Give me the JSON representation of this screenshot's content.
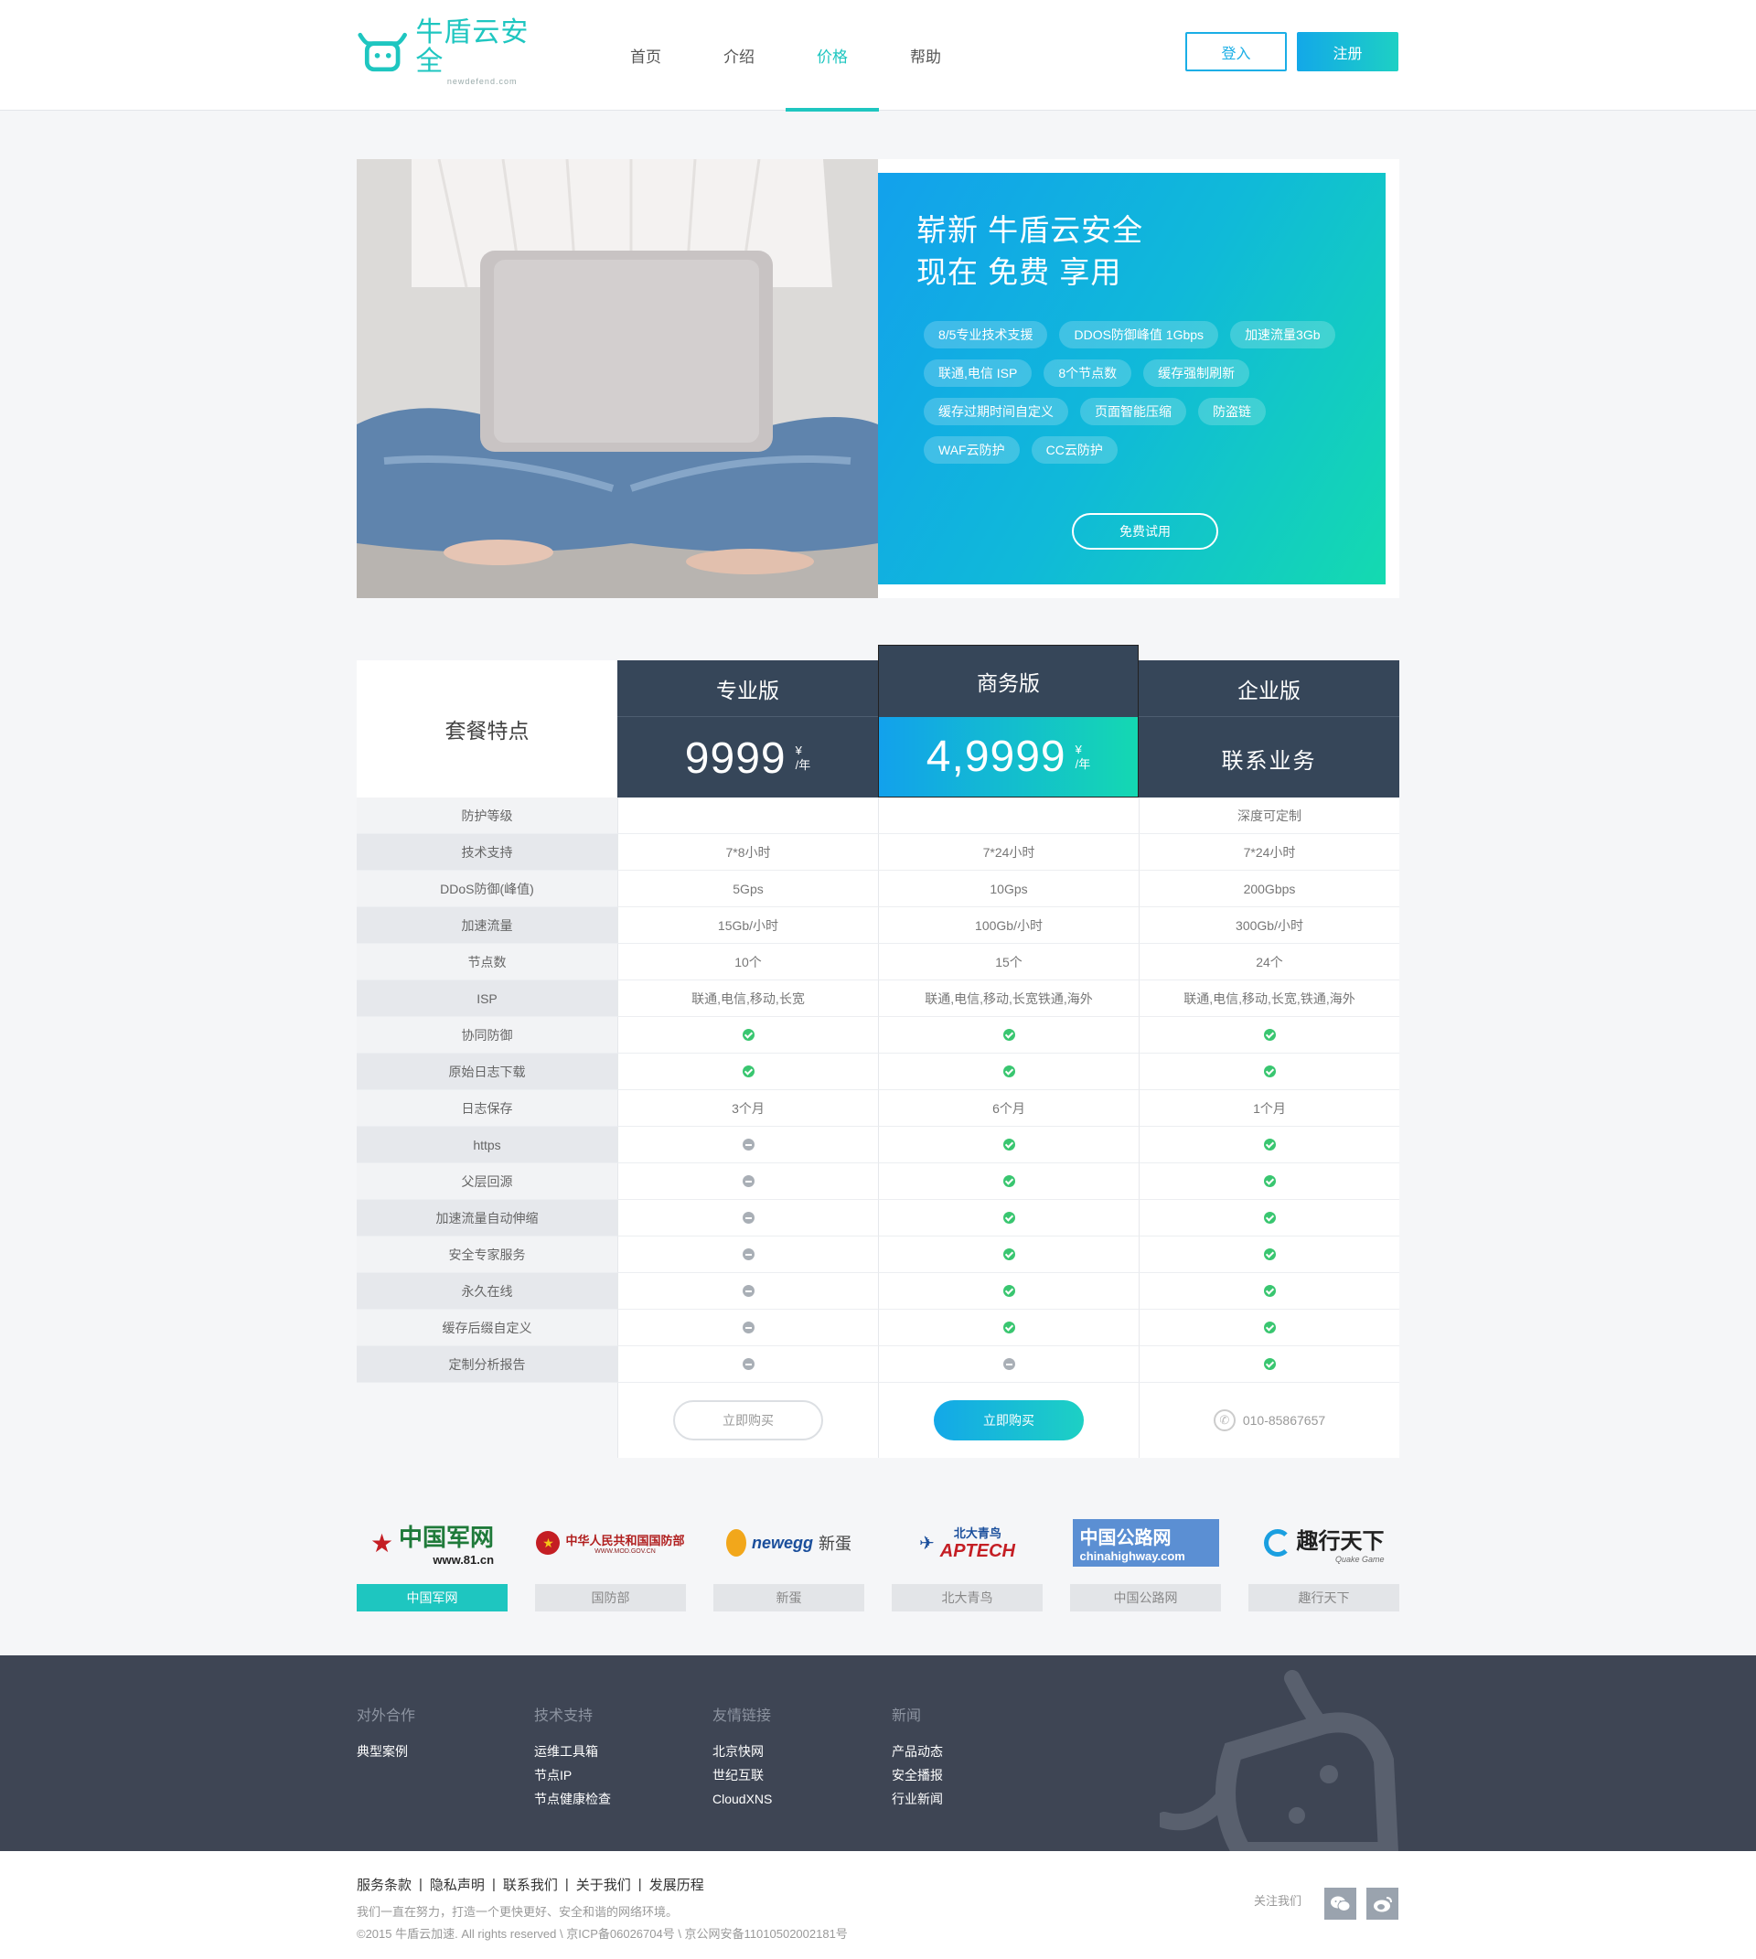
{
  "brand": {
    "name": "牛盾云安全",
    "domain": "newdefend.com",
    "accent": "#1ec6c0",
    "blue": "#13a8e8"
  },
  "nav": {
    "items": [
      "首页",
      "介绍",
      "价格",
      "帮助"
    ],
    "active": "价格",
    "login": "登入",
    "register": "注册"
  },
  "hero": {
    "title_line1": "崭新 牛盾云安全",
    "title_line2": "现在 免费 享用",
    "tags": [
      "8/5专业技术支援",
      "DDOS防御峰值 1Gbps",
      "加速流量3Gb",
      "联通,电信 ISP",
      "8个节点数",
      "缓存强制刷新",
      "缓存过期时间自定义",
      "页面智能压缩",
      "防盗链",
      "WAF云防护",
      "CC云防护"
    ],
    "cta": "免费试用"
  },
  "pricing": {
    "feature_header": "套餐特点",
    "plans": [
      {
        "name": "专业版",
        "price": "9999",
        "currency": "¥",
        "per": "/年"
      },
      {
        "name": "商务版",
        "price": "4,9999",
        "currency": "¥",
        "per": "/年"
      },
      {
        "name": "企业版",
        "contact": "联系业务"
      }
    ],
    "rows": [
      {
        "feature": "防护等级",
        "values": [
          "",
          "",
          "深度可定制"
        ]
      },
      {
        "feature": "技术支持",
        "values": [
          "7*8小时",
          "7*24小时",
          "7*24小时"
        ]
      },
      {
        "feature": "DDoS防御(峰值)",
        "values": [
          "5Gps",
          "10Gps",
          "200Gbps"
        ]
      },
      {
        "feature": "加速流量",
        "values": [
          "15Gb/小时",
          "100Gb/小时",
          "300Gb/小时"
        ]
      },
      {
        "feature": "节点数",
        "values": [
          "10个",
          "15个",
          "24个"
        ]
      },
      {
        "feature": "ISP",
        "values": [
          "联通,电信,移动,长宽",
          "联通,电信,移动,长宽铁通,海外",
          "联通,电信,移动,长宽,铁通,海外"
        ]
      },
      {
        "feature": "协同防御",
        "values": [
          "yes",
          "yes",
          "yes"
        ]
      },
      {
        "feature": "原始日志下载",
        "values": [
          "yes",
          "yes",
          "yes"
        ]
      },
      {
        "feature": "日志保存",
        "values": [
          "3个月",
          "6个月",
          "1个月"
        ]
      },
      {
        "feature": "https",
        "values": [
          "no",
          "yes",
          "yes"
        ]
      },
      {
        "feature": "父层回源",
        "values": [
          "no",
          "yes",
          "yes"
        ]
      },
      {
        "feature": "加速流量自动伸缩",
        "values": [
          "no",
          "yes",
          "yes"
        ]
      },
      {
        "feature": "安全专家服务",
        "values": [
          "no",
          "yes",
          "yes"
        ]
      },
      {
        "feature": "永久在线",
        "values": [
          "no",
          "yes",
          "yes"
        ]
      },
      {
        "feature": "缓存后缀自定义",
        "values": [
          "no",
          "yes",
          "yes"
        ]
      },
      {
        "feature": "定制分析报告",
        "values": [
          "no",
          "no",
          "yes"
        ]
      }
    ],
    "buy_label": "立即购买",
    "phone": "010-85867657"
  },
  "partners": [
    {
      "label": "中国军网",
      "logo_text": "中国军网",
      "logo_sub": "www.81.cn",
      "icon": "star-emblem-icon",
      "active": true
    },
    {
      "label": "国防部",
      "logo_text": "中华人民共和国国防部",
      "logo_sub": "WWW.MOD.GOV.CN",
      "icon": "national-emblem-icon",
      "active": false
    },
    {
      "label": "新蛋",
      "logo_text": "newegg",
      "logo_sub": "新蛋",
      "icon": "egg-icon",
      "active": false
    },
    {
      "label": "北大青鸟",
      "logo_text": "APTECH",
      "logo_sub": "北大青鸟",
      "icon": "bird-icon",
      "active": false
    },
    {
      "label": "中国公路网",
      "logo_text": "中国公路网",
      "logo_sub": "chinahighway.com",
      "icon": "road-icon",
      "active": false
    },
    {
      "label": "趣行天下",
      "logo_text": "趣行天下",
      "logo_sub": "Quake Game",
      "icon": "swirl-icon",
      "active": false
    }
  ],
  "footer": {
    "columns": [
      {
        "title": "对外合作",
        "links": [
          "典型案例"
        ]
      },
      {
        "title": "技术支持",
        "links": [
          "运维工具箱",
          "节点IP",
          "节点健康检查"
        ]
      },
      {
        "title": "友情链接",
        "links": [
          "北京快网",
          "世纪互联",
          "CloudXNS"
        ]
      },
      {
        "title": "新闻",
        "links": [
          "产品动态",
          "安全播报",
          "行业新闻"
        ]
      }
    ],
    "bottom_links": [
      "服务条款",
      "隐私声明",
      "联系我们",
      "关于我们",
      "发展历程"
    ],
    "slogan": "我们一直在努力，打造一个更快更好、安全和谐的网络环境。",
    "copyright": "©2015 牛盾云加速. All rights reserved \\ 京ICP备06026704号 \\ 京公网安备11010502002181号",
    "follow": "关注我们",
    "social": [
      "wechat-icon",
      "weibo-icon"
    ]
  }
}
